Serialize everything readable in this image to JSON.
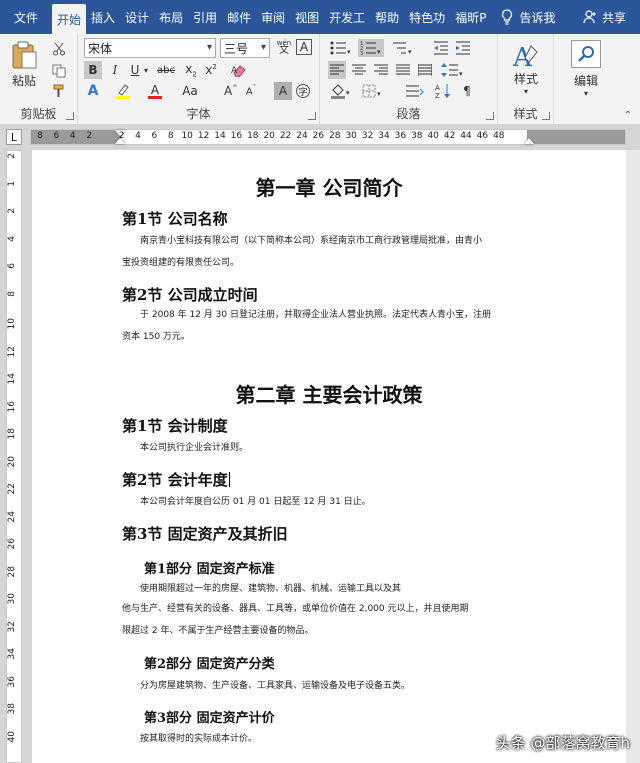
{
  "tabs": [
    {
      "label": "文件"
    },
    {
      "label": "开始"
    },
    {
      "label": "插入"
    },
    {
      "label": "设计"
    },
    {
      "label": "布局"
    },
    {
      "label": "引用"
    },
    {
      "label": "邮件"
    },
    {
      "label": "审阅"
    },
    {
      "label": "视图"
    },
    {
      "label": "开发工"
    },
    {
      "label": "帮助"
    },
    {
      "label": "特色功"
    },
    {
      "label": "福昕P"
    }
  ],
  "tell_me": "告诉我",
  "share": "共享",
  "ribbon": {
    "clipboard": {
      "label": "剪贴板",
      "paste": "粘贴"
    },
    "font": {
      "label": "字体",
      "font_name": "宋体",
      "font_size": "三号",
      "phonetic": "wén",
      "aa_label": "Aa"
    },
    "paragraph": {
      "label": "段落"
    },
    "styles": {
      "label": "样式",
      "button": "样式"
    },
    "editing": {
      "button": "编辑"
    }
  },
  "ruler": {
    "corner": "L",
    "h_ticks": [
      "8",
      "6",
      "4",
      "2",
      "2",
      "4",
      "6",
      "8",
      "10",
      "12",
      "14",
      "16",
      "18",
      "20",
      "22",
      "24",
      "26",
      "28",
      "30",
      "32",
      "34",
      "36",
      "38",
      "40",
      "42",
      "44",
      "46",
      "48"
    ],
    "v_ticks": [
      "2",
      "1",
      "2",
      "4",
      "6",
      "8",
      "10",
      "12",
      "14",
      "16",
      "18",
      "20",
      "22",
      "24",
      "26",
      "28",
      "30",
      "32",
      "34",
      "36",
      "38",
      "40"
    ]
  },
  "document": {
    "chapter1": "第一章   公司简介",
    "c1s1": "第1节  公司名称",
    "c1s1_p1": "南京青小宝科技有限公司（以下简称本公司）系经南京市工商行政管理局批准，由青小",
    "c1s1_p2": "宝投资组建的有限责任公司。",
    "c1s2": "第2节  公司成立时间",
    "c1s2_p1": "于 2008 年 12 月 30 日登记注册，并取得企业法人营业执照。法定代表人青小宝，注册",
    "c1s2_p2": "资本 150 万元。",
    "chapter2": "第二章   主要会计政策",
    "c2s1": "第1节  会计制度",
    "c2s1_p1": "本公司执行企业会计准则。",
    "c2s2": "第2节  会计年度",
    "c2s2_p1": "本公司会计年度自公历 01 月 01 日起至 12 月 31 日止。",
    "c2s3": "第3节  固定资产及其折旧",
    "p1": "第1部分  固定资产标准",
    "p1_l1": "使用期限超过一年的房屋、建筑物、机器、机械、运输工具以及其",
    "p1_l2": "他与生产、经营有关的设备、器具、工具等，或单位价值在 2,000 元以上，并且使用期",
    "p1_l3": "限超过 2 年、不属于生产经营主要设备的物品。",
    "p2": "第2部分  固定资产分类",
    "p2_l1": "分为房屋建筑物、生产设备、工具家具、运输设备及电子设备五类。",
    "p3": "第3部分  固定资产计价",
    "p3_l1": "按其取得时的实际成本计价。"
  },
  "watermark": "头条 @部落窝教育h"
}
